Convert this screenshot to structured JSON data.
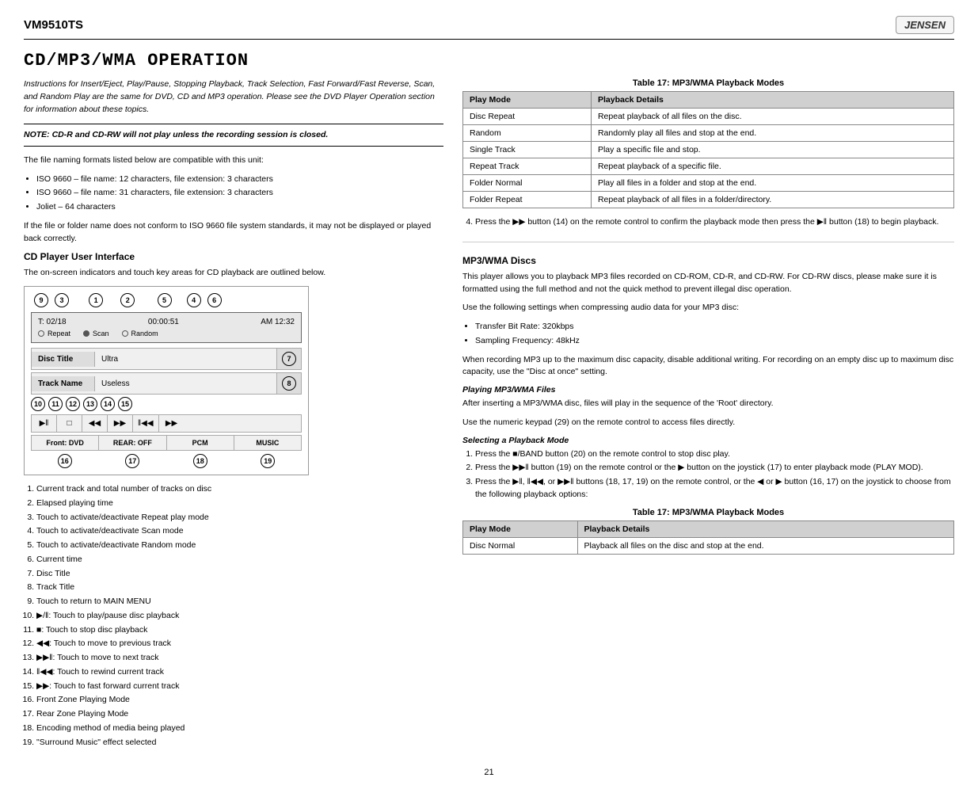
{
  "header": {
    "model": "VM9510TS",
    "logo": "JENSEN"
  },
  "title": "CD/MP3/WMA OPERATION",
  "intro": "Instructions for Insert/Eject, Play/Pause, Stopping Playback, Track Selection, Fast Forward/Fast Reverse, Scan, and Random Play are the same for DVD, CD and MP3 operation. Please see the DVD Player Operation section for information about these topics.",
  "note": "NOTE: CD-R and CD-RW will not play unless the recording session is closed.",
  "body1": "The file naming formats listed below are compatible with this unit:",
  "bullets1": [
    "ISO 9660 – file name: 12 characters, file extension: 3 characters",
    "ISO 9660 – file name: 31 characters, file extension: 3 characters",
    "Joliet – 64 characters"
  ],
  "body2": "If the file or folder name does not conform to ISO 9660 file system standards, it may not be displayed or played back correctly.",
  "subhead1": "CD Player User Interface",
  "body3": "The on-screen indicators and touch key areas for CD playback are outlined below.",
  "diagram": {
    "top_numbers": [
      "9",
      "3",
      "1",
      "2",
      "5",
      "4",
      "6"
    ],
    "screen": {
      "track_time": "T: 02/18",
      "elapsed": "00:00:51",
      "clock": "AM 12:32",
      "repeat_label": "Repeat",
      "scan_label": "Scan",
      "random_label": "Random"
    },
    "disc_title_label": "Disc Title",
    "disc_title_value": "Ultra",
    "disc_title_num": "7",
    "track_name_label": "Track Name",
    "track_name_value": "Useless",
    "track_name_num": "8",
    "ctrl_nums": [
      "10",
      "11",
      "12",
      "13",
      "14",
      "15"
    ],
    "ctrl_btns": [
      "▶‖",
      "□",
      "◀◀",
      "▶▶",
      "◀◀",
      "▶▶"
    ],
    "status": [
      "Front: DVD",
      "REAR: OFF",
      "PCM",
      "MUSIC"
    ],
    "bottom_nums": [
      "16",
      "17",
      "18",
      "19"
    ]
  },
  "numbered_items": [
    "Current track and total number of tracks on disc",
    "Elapsed playing time",
    "Touch to activate/deactivate Repeat play mode",
    "Touch to activate/deactivate Scan mode",
    "Touch to activate/deactivate Random mode",
    "Current time",
    "Disc Title",
    "Track Title",
    "Touch to return to MAIN MENU",
    "▶/‖: Touch to play/pause disc playback",
    "■: Touch to stop disc playback",
    "◀◀: Touch to move to previous track",
    "▶▶‖: Touch to move to next track",
    "‖◀◀: Touch to rewind current track",
    "▶▶: Touch to fast forward current track",
    "Front Zone Playing Mode",
    "Rear Zone Playing Mode",
    "Encoding method of media being played",
    "\"Surround Music\" effect selected"
  ],
  "mp3_subhead": "MP3/WMA Discs",
  "mp3_body1": "This player allows you to playback MP3 files recorded on CD-ROM, CD-R, and CD-RW. For CD-RW discs, please make sure it is formatted using the full method and not the quick method to prevent illegal disc operation.",
  "mp3_body2": "Use the following settings when compressing audio data for your MP3 disc:",
  "mp3_bullets": [
    "Transfer Bit Rate: 320kbps",
    "Sampling Frequency: 48kHz"
  ],
  "mp3_body3": "When recording MP3 up to the maximum disc capacity, disable additional writing. For recording on an empty disc up to maximum disc capacity, use the \"Disc at once\" setting.",
  "playing_subhead": "Playing MP3/WMA Files",
  "playing_body1": "After inserting a MP3/WMA disc, files will play in the sequence of the 'Root' directory.",
  "playing_body2": "Use the numeric keypad (29) on the remote control to access files directly.",
  "select_subhead": "Selecting a Playback Mode",
  "select_steps": [
    "Press the ■/BAND button (20) on the remote control to stop disc play.",
    "Press the ▶▶‖ button (19) on the remote control or the ▶ button on the joystick (17) to enter playback mode (PLAY MOD).",
    "Press the ▶‖, ‖◀◀, or ▶▶‖ buttons (18, 17, 19) on the remote control, or the ◀ or ▶ button (16, 17) on the joystick to choose from the following playback options:"
  ],
  "table1_title": "Table 17: MP3/WMA Playback Modes",
  "table1_headers": [
    "Play Mode",
    "Playback Details"
  ],
  "table1_rows": [
    [
      "Disc Normal",
      "Playback all files on the disc and stop at the end."
    ]
  ],
  "right_table_title": "Table 17: MP3/WMA Playback Modes",
  "right_table_headers": [
    "Play Mode",
    "Playback Details"
  ],
  "right_table_rows": [
    [
      "Disc Repeat",
      "Repeat playback of all files on the disc."
    ],
    [
      "Random",
      "Randomly play all files and stop at the end."
    ],
    [
      "Single Track",
      "Play a specific file and stop."
    ],
    [
      "Repeat Track",
      "Repeat playback of a specific file."
    ],
    [
      "Folder Normal",
      "Play all files in a folder and stop at the end."
    ],
    [
      "Folder Repeat",
      "Repeat playback of all files in a folder/directory."
    ]
  ],
  "right_step4": "Press the ▶▶ button (14) on the remote control to confirm the playback mode then press the ▶‖ button (18) to begin playback.",
  "page_number": "21"
}
